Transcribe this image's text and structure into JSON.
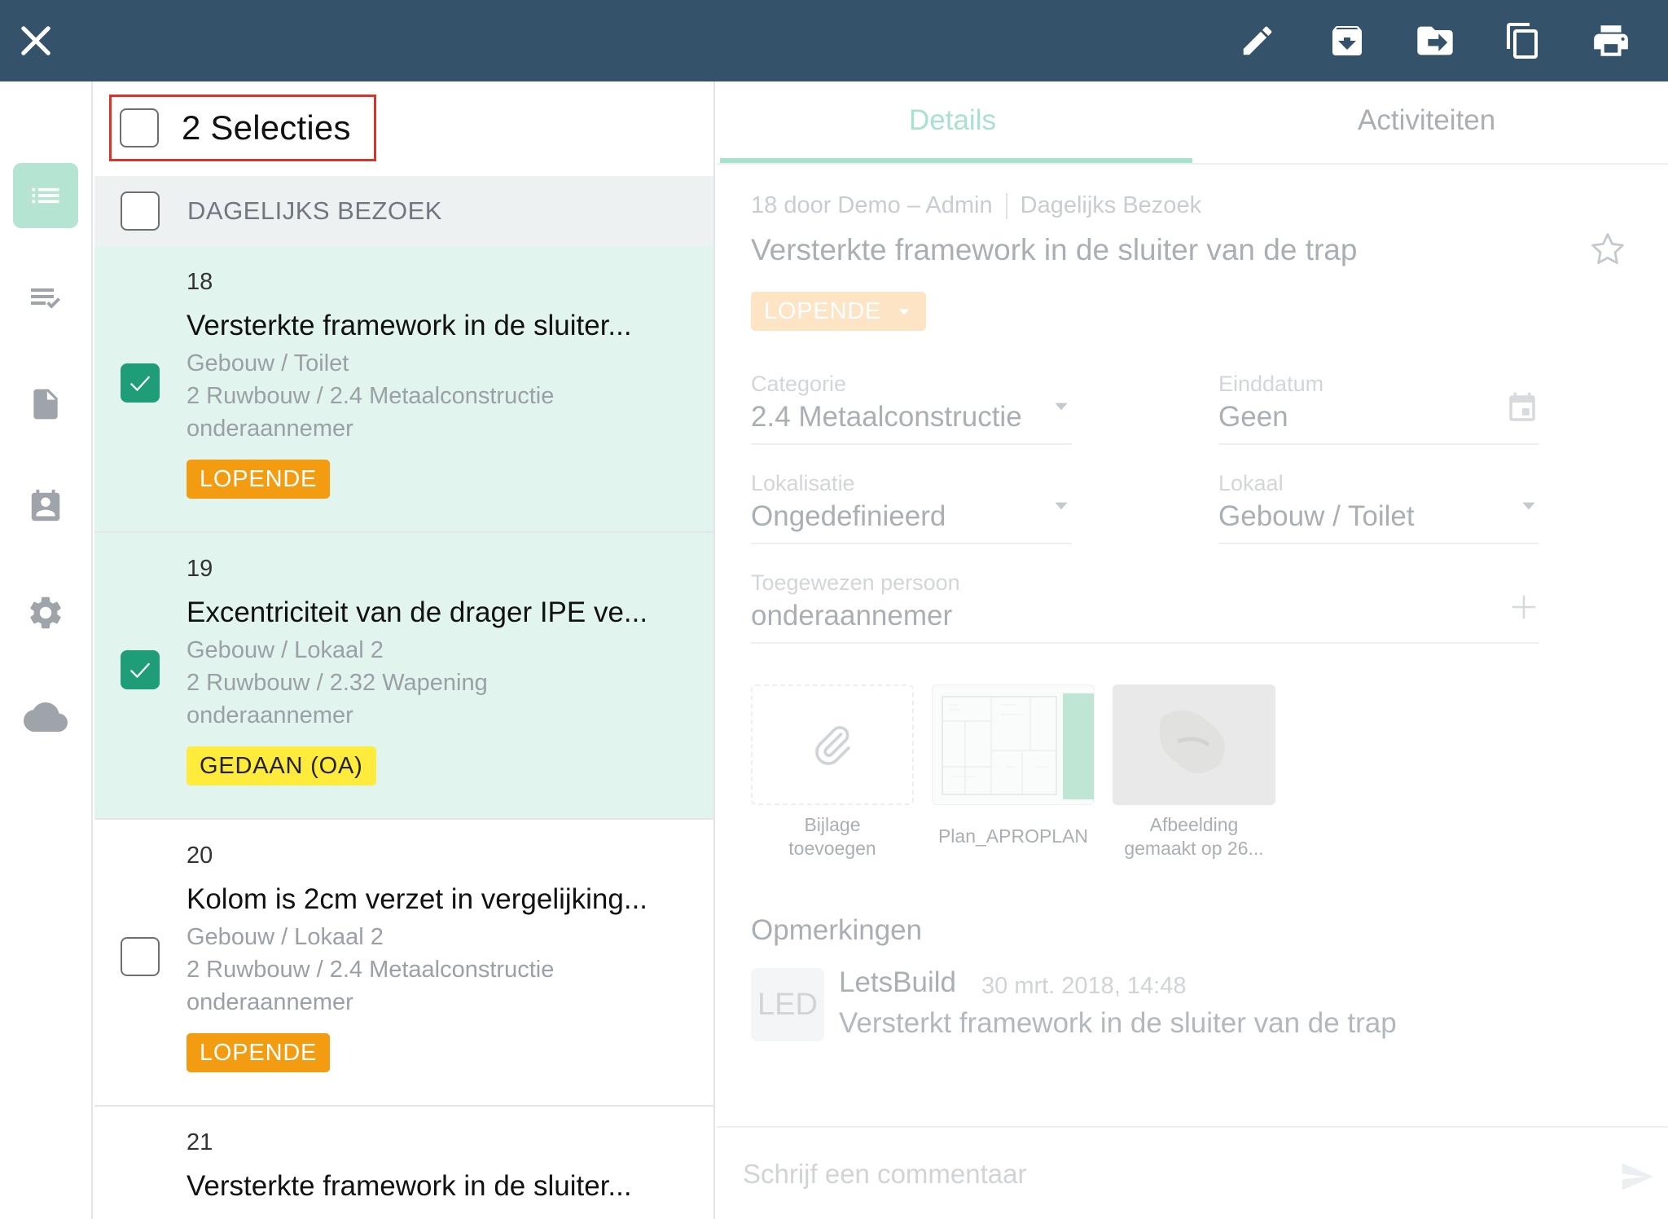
{
  "selection": {
    "title": "2 Selecties"
  },
  "group": {
    "title": "DAGELIJKS BEZOEK"
  },
  "items": [
    {
      "num": "18",
      "title": "Versterkte framework in de sluiter...",
      "location": "Gebouw / Toilet",
      "category": "2 Ruwbouw / 2.4 Metaalconstructie",
      "assignee": "onderaannemer",
      "status": "LOPENDE"
    },
    {
      "num": "19",
      "title": "Excentriciteit van de drager IPE ve...",
      "location": "Gebouw / Lokaal 2",
      "category": "2 Ruwbouw / 2.32 Wapening",
      "assignee": "onderaannemer",
      "status": "GEDAAN (OA)"
    },
    {
      "num": "20",
      "title": "Kolom is 2cm verzet in vergelijking...",
      "location": "Gebouw / Lokaal 2",
      "category": "2 Ruwbouw / 2.4 Metaalconstructie",
      "assignee": "onderaannemer",
      "status": "LOPENDE"
    },
    {
      "num": "21",
      "title": "Versterkte framework in de sluiter..."
    }
  ],
  "tabs": {
    "details": "Details",
    "activities": "Activiteiten"
  },
  "detail": {
    "crumb_author": "18 door Demo – Admin",
    "crumb_group": "Dagelijks Bezoek",
    "title": "Versterkte framework in de sluiter van de trap",
    "status": "LOPENDE",
    "fields": {
      "category_label": "Categorie",
      "category_value": "2.4 Metaalconstructie",
      "enddate_label": "Einddatum",
      "enddate_value": "Geen",
      "localisation_label": "Lokalisatie",
      "localisation_value": "Ongedefinieerd",
      "room_label": "Lokaal",
      "room_value": "Gebouw / Toilet",
      "assignee_label": "Toegewezen persoon",
      "assignee_value": "onderaannemer"
    },
    "attachments": {
      "add_line1": "Bijlage",
      "add_line2": "toevoegen",
      "plan": "Plan_APROPLAN",
      "image_line1": "Afbeelding",
      "image_line2": "gemaakt op 26..."
    },
    "remarks": {
      "title": "Opmerkingen",
      "avatar": "LED",
      "author": "LetsBuild",
      "date": "30 mrt. 2018, 14:48",
      "text": "Versterkt framework in de sluiter van de trap"
    },
    "composer_placeholder": "Schrijf een commentaar"
  },
  "colors": {
    "topbar": "#34536b",
    "accent": "#1f9c78",
    "selected_row": "#e2f4ee",
    "badge_lopende": "#f39c12",
    "badge_gedaan": "#ffeb3b",
    "highlight": "#d9342b"
  },
  "icons": [
    "close-icon",
    "edit-icon",
    "archive-icon",
    "move-icon",
    "copy-icon",
    "print-icon",
    "list-icon",
    "checklist-icon",
    "document-icon",
    "contacts-icon",
    "settings-icon",
    "cloud-icon",
    "star-icon",
    "dropdown-arrow-icon",
    "calendar-icon",
    "plus-icon",
    "paperclip-icon",
    "send-icon",
    "check-icon"
  ]
}
